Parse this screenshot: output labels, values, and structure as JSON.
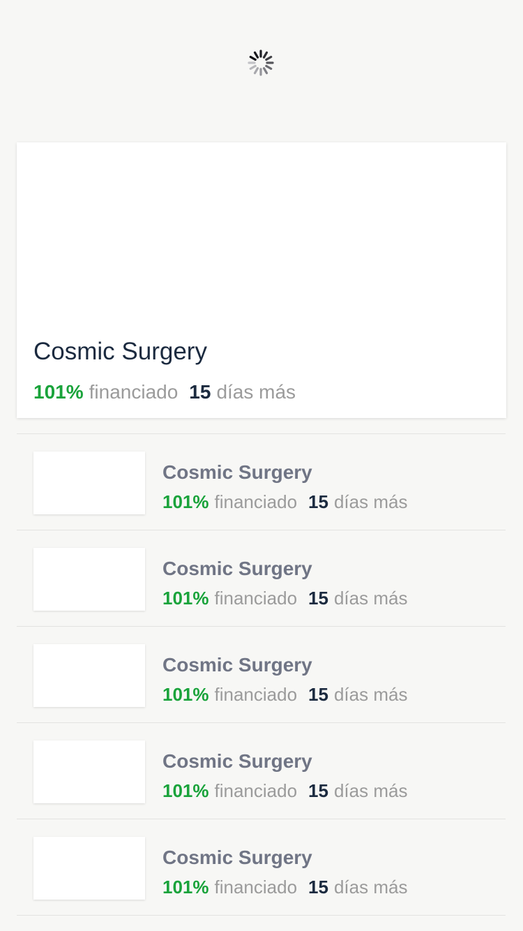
{
  "featured": {
    "title": "Cosmic Surgery",
    "percent": "101%",
    "funded_label": "financiado",
    "days": "15",
    "days_label": "días más"
  },
  "projects": [
    {
      "title": "Cosmic Surgery",
      "percent": "101%",
      "funded_label": "financiado",
      "days": "15",
      "days_label": "días más"
    },
    {
      "title": "Cosmic Surgery",
      "percent": "101%",
      "funded_label": "financiado",
      "days": "15",
      "days_label": "días más"
    },
    {
      "title": "Cosmic Surgery",
      "percent": "101%",
      "funded_label": "financiado",
      "days": "15",
      "days_label": "días más"
    },
    {
      "title": "Cosmic Surgery",
      "percent": "101%",
      "funded_label": "financiado",
      "days": "15",
      "days_label": "días más"
    },
    {
      "title": "Cosmic Surgery",
      "percent": "101%",
      "funded_label": "financiado",
      "days": "15",
      "days_label": "días más"
    }
  ],
  "colors": {
    "background": "#f7f7f5",
    "percent_green": "#1aa33b",
    "title_dark": "#1b2a3f",
    "item_title_gray": "#707585",
    "muted_gray": "#9b9b9b"
  },
  "icons": {
    "loading": "loading-spinner-icon"
  }
}
